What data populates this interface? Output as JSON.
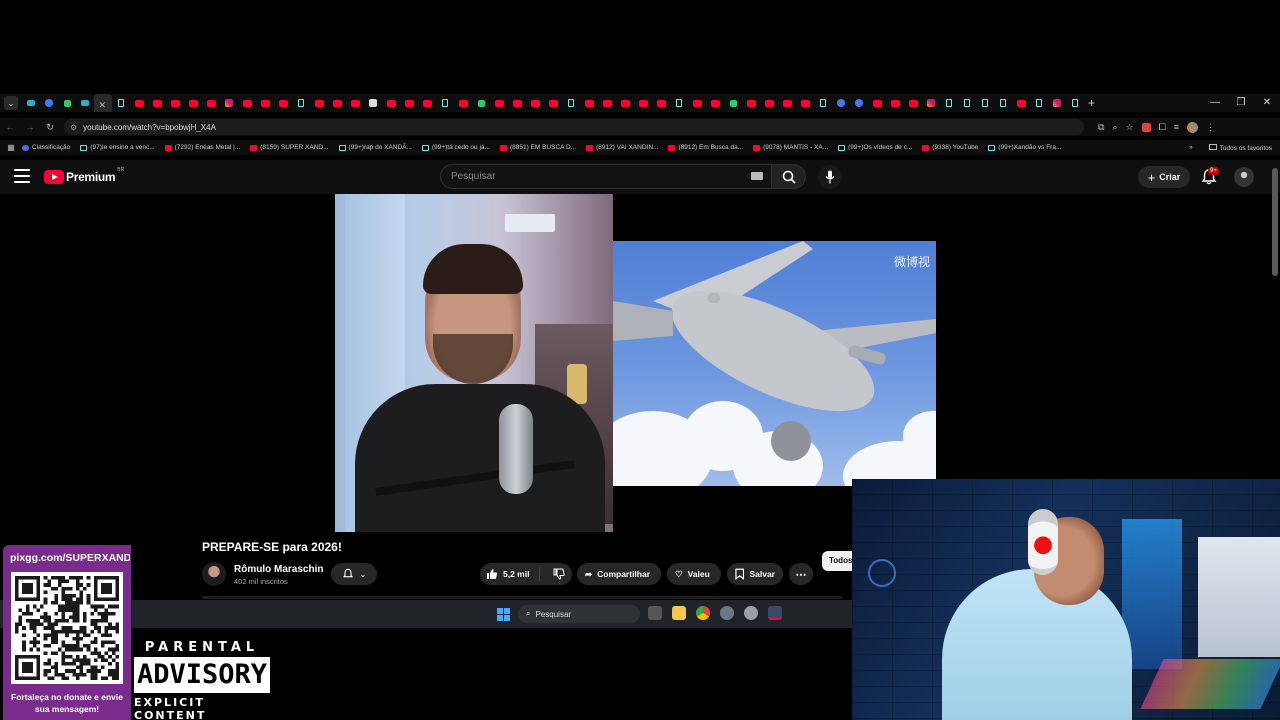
{
  "browser": {
    "tabs": [
      "cy",
      "bl",
      "gr",
      "cy",
      "active",
      "tt",
      "yt",
      "yt",
      "yt",
      "yt",
      "yt",
      "ig",
      "yt",
      "yt",
      "yt",
      "tt",
      "yt",
      "yt",
      "yt",
      "wh",
      "yt",
      "yt",
      "yt",
      "tt",
      "yt",
      "gr",
      "yt",
      "yt",
      "yt",
      "yt",
      "tt",
      "yt",
      "yt",
      "yt",
      "yt",
      "yt",
      "tt",
      "yt",
      "yt",
      "gr",
      "yt",
      "yt",
      "yt",
      "yt",
      "tt",
      "bl",
      "bl",
      "yt",
      "yt",
      "yt",
      "ig",
      "tt",
      "tt",
      "tt",
      "tt",
      "yt",
      "tt",
      "ig",
      "tt"
    ],
    "new_tab_icon": "+",
    "window_controls": [
      "—",
      "❐",
      "✕"
    ],
    "url": "youtube.com/watch?v=bpobwjH_X4A",
    "bookmarks": [
      {
        "icon": "gc",
        "label": "Classificação"
      },
      {
        "icon": "tt",
        "label": "(97)Ie ensino a venc..."
      },
      {
        "icon": "yt",
        "label": "(7292) Enéas Metal |..."
      },
      {
        "icon": "yt",
        "label": "(8159) SUPER XAND..."
      },
      {
        "icon": "tt",
        "label": "(99+)rap do XANDÃ..."
      },
      {
        "icon": "tt",
        "label": "(99+)tá cedo ou já..."
      },
      {
        "icon": "yt",
        "label": "(8851) EM BUSCA D..."
      },
      {
        "icon": "yt",
        "label": "(8912) VAI XANDIN..."
      },
      {
        "icon": "yt",
        "label": "(8912) Em Busca da..."
      },
      {
        "icon": "yt",
        "label": "(9078) MANTIS - XA..."
      },
      {
        "icon": "tt",
        "label": "(99+)Os vídeos de c..."
      },
      {
        "icon": "yt",
        "label": "(9338) YouTube"
      },
      {
        "icon": "tt",
        "label": "(99+)Xandão vs Fra..."
      }
    ],
    "bookmarks_overflow": "»",
    "all_bookmarks": "Todos os favoritos"
  },
  "youtube": {
    "logo_text": "Premium",
    "region": "BR",
    "search_placeholder": "Pesquisar",
    "create_label": "Criar",
    "notifications_badge": "9+",
    "watermark": "微博视",
    "video": {
      "title": "PREPARE-SE para 2026!",
      "channel": "Rômulo Maraschin",
      "subscribers": "402 mil inscritos",
      "likes": "5,2 mil",
      "share": "Compartilhar",
      "thanks": "Valeu",
      "save": "Salvar",
      "more": "⋯"
    },
    "chip_all": "Todos"
  },
  "taskbar": {
    "search_placeholder": "Pesquisar"
  },
  "overlay": {
    "qr_url": "pixgg.com/SUPERXANDÃO",
    "qr_caption": "Fortaleça no donate e envie sua mensagem!",
    "parental_top": "PARENTAL",
    "parental_mid": "ADVISORY",
    "parental_bottom": "EXPLICIT CONTENT"
  },
  "colors": {
    "youtube_red": "#ff0033",
    "background": "#0f0f0f",
    "qr_panel": "#7a2c8c"
  }
}
